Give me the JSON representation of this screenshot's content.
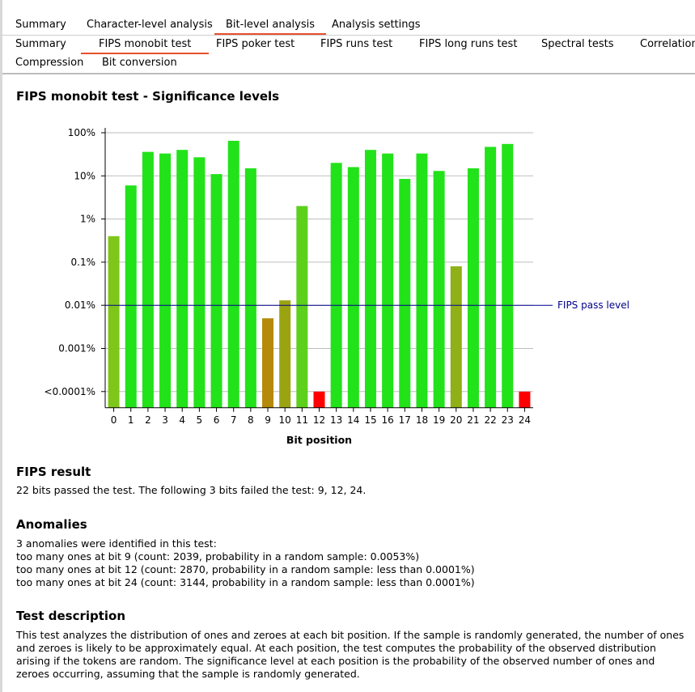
{
  "tabs_main": [
    "Summary",
    "Character-level analysis",
    "Bit-level analysis",
    "Analysis settings"
  ],
  "tabs_sub_row1": [
    "Summary",
    "FIPS monobit test",
    "FIPS poker test",
    "FIPS runs test",
    "FIPS long runs test",
    "Spectral tests",
    "Correlation"
  ],
  "tabs_sub_row2": [
    "Compression",
    "Bit conversion"
  ],
  "section_title": "FIPS monobit test - Significance levels",
  "chart_data": {
    "type": "bar",
    "title": "",
    "xlabel": "Bit position",
    "ylabel": "",
    "scale": "log",
    "categories": [
      "0",
      "1",
      "2",
      "3",
      "4",
      "5",
      "6",
      "7",
      "8",
      "9",
      "10",
      "11",
      "12",
      "13",
      "14",
      "15",
      "16",
      "17",
      "18",
      "19",
      "20",
      "21",
      "22",
      "23",
      "24"
    ],
    "values": [
      0.4,
      6,
      36,
      33,
      40,
      27,
      11,
      65,
      15,
      0.005,
      0.013,
      2,
      0.0001,
      20,
      16,
      40,
      33,
      8.5,
      33,
      13,
      0.08,
      15,
      47,
      55,
      0.0001
    ],
    "bar_colors": [
      "#7fc61a",
      "#22e21a",
      "#22e21a",
      "#22e21a",
      "#22e21a",
      "#22e21a",
      "#22e21a",
      "#22e21a",
      "#22e21a",
      "#b58a0a",
      "#9aa410",
      "#5cd01a",
      "#ff0000",
      "#22e21a",
      "#22e21a",
      "#22e21a",
      "#22e21a",
      "#22e21a",
      "#22e21a",
      "#22e21a",
      "#8fb016",
      "#22e21a",
      "#22e21a",
      "#22e21a",
      "#ff0000"
    ],
    "y_ticks": [
      "100%",
      "10%",
      "1%",
      "0.1%",
      "0.01%",
      "0.001%",
      "<0.0001%"
    ],
    "pass_line_label": "FIPS pass level",
    "pass_line_value": 0.01,
    "pass_line_color": "#00008b",
    "grid": true
  },
  "fips_result": {
    "heading": "FIPS result",
    "text": "22 bits passed the test. The following 3 bits failed the test: 9, 12, 24."
  },
  "anomalies": {
    "heading": "Anomalies",
    "lines": [
      "3 anomalies were identified in this test:",
      "too many ones at bit 9 (count: 2039, probability in a random sample: 0.0053%)",
      "too many ones at bit 12 (count: 2870, probability in a random sample: less than 0.0001%)",
      "too many ones at bit 24 (count: 3144, probability in a random sample: less than 0.0001%)"
    ]
  },
  "test_description": {
    "heading": "Test description",
    "text": "This test analyzes the distribution of ones and zeroes at each bit position. If the sample is randomly generated, the number of ones and zeroes is likely to be approximately equal. At each position, the test computes the probability of the observed distribution arising if the tokens are random. The significance level at each position is the probability of the observed number of ones and zeroes occurring, assuming that the sample is randomly generated."
  },
  "colors": {
    "accent": "#e8502a",
    "pass": "#22e21a",
    "fail": "#ff0000"
  }
}
